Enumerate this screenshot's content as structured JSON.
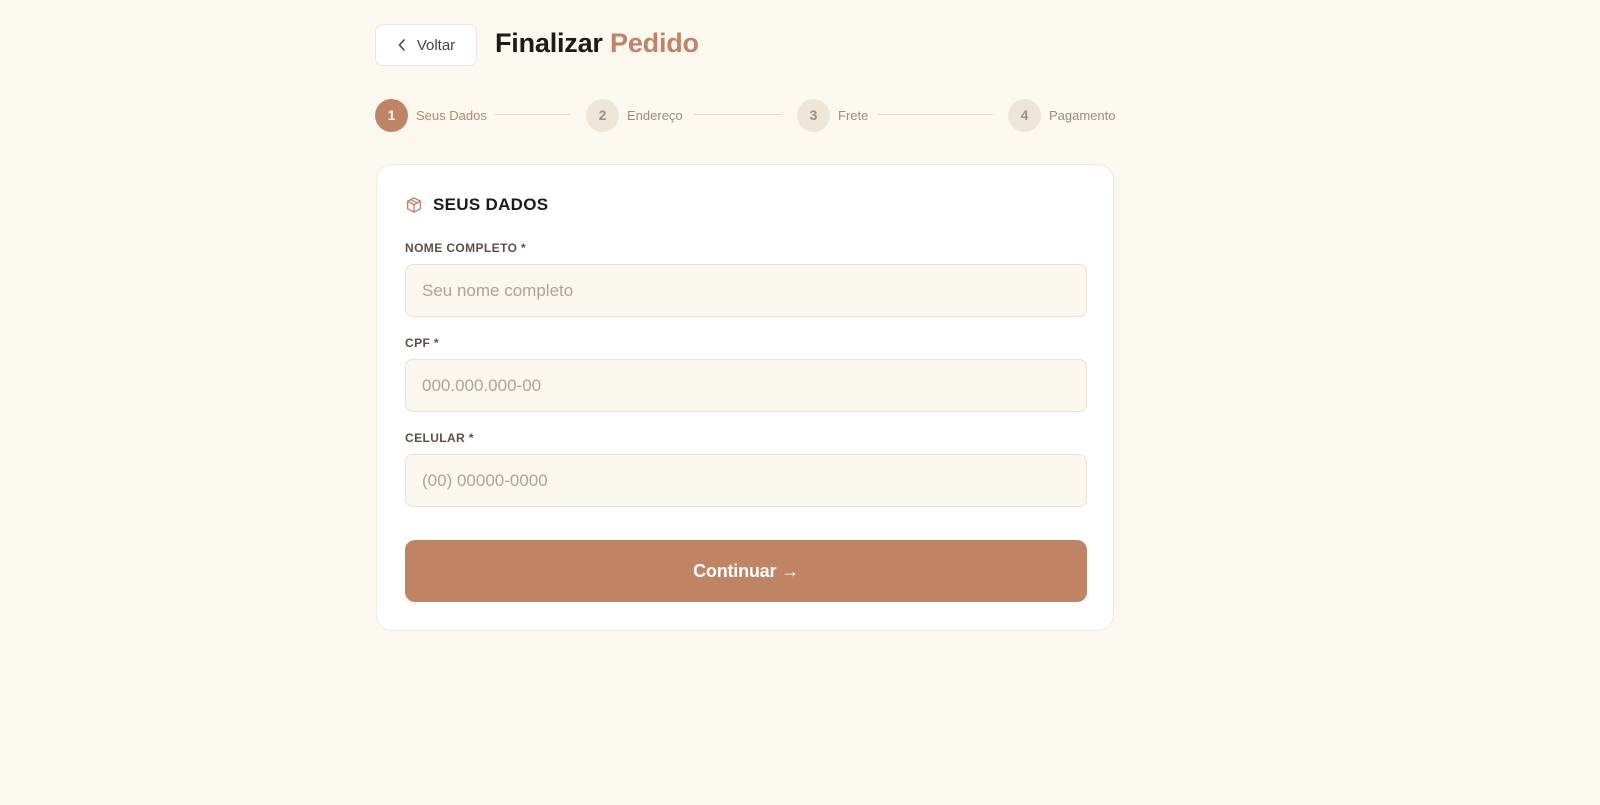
{
  "header": {
    "back_label": "Voltar",
    "title_main": "Finalizar",
    "title_accent": "Pedido"
  },
  "stepper": {
    "steps": [
      {
        "number": "1",
        "label": "Seus Dados",
        "active": true
      },
      {
        "number": "2",
        "label": "Endereço",
        "active": false
      },
      {
        "number": "3",
        "label": "Frete",
        "active": false
      },
      {
        "number": "4",
        "label": "Pagamento",
        "active": false
      }
    ]
  },
  "form": {
    "section_icon": "package-icon",
    "section_title": "SEUS DADOS",
    "fields": [
      {
        "label": "NOME COMPLETO *",
        "placeholder": "Seu nome completo",
        "value": ""
      },
      {
        "label": "CPF *",
        "placeholder": "000.000.000-00",
        "value": ""
      },
      {
        "label": "CELULAR *",
        "placeholder": "(00) 00000-0000",
        "value": ""
      }
    ],
    "submit_label": "Continuar →"
  },
  "colors": {
    "accent": "#C08465",
    "background": "#FBF8F0",
    "card": "#FFFFFF",
    "input_bg": "#FAF7EE",
    "step_inactive": "#EDE6D8"
  }
}
